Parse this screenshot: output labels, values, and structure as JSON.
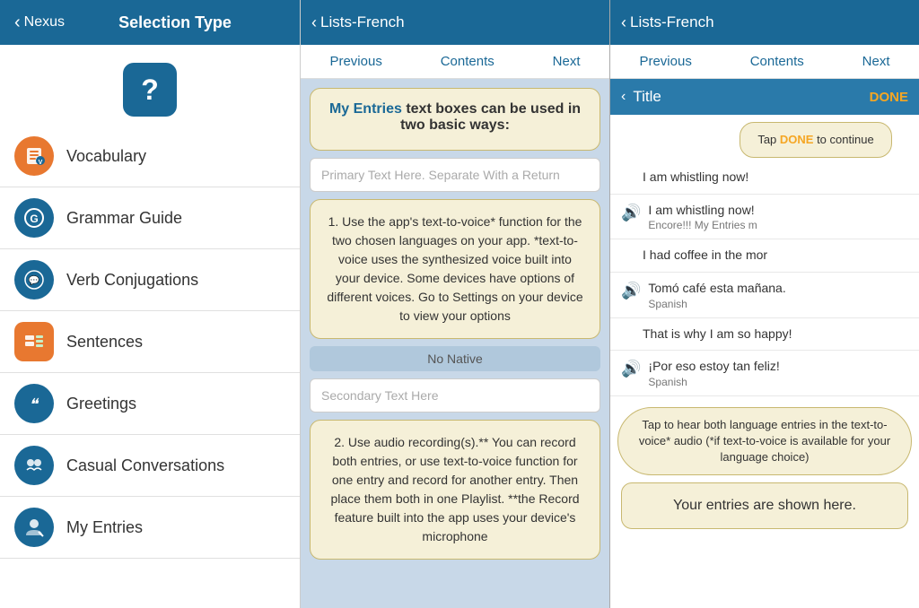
{
  "left": {
    "back_label": "Nexus",
    "title": "Selection Type",
    "items": [
      {
        "id": "vocabulary",
        "label": "Vocabulary",
        "icon": "📚",
        "icon_bg": "#1a6896"
      },
      {
        "id": "grammar",
        "label": "Grammar Guide",
        "icon": "📖",
        "icon_bg": "#1a6896"
      },
      {
        "id": "verb",
        "label": "Verb Conjugations",
        "icon": "💬",
        "icon_bg": "#1a6896"
      },
      {
        "id": "sentences",
        "label": "Sentences",
        "icon": "🔤",
        "icon_bg": "#e87830"
      },
      {
        "id": "greetings",
        "label": "Greetings",
        "icon": "❝",
        "icon_bg": "#1a6896"
      },
      {
        "id": "casual",
        "label": "Casual Conversations",
        "icon": "🤝",
        "icon_bg": "#1a6896"
      },
      {
        "id": "myentries",
        "label": "My Entries",
        "icon": "✍️",
        "icon_bg": "#1a6896"
      }
    ]
  },
  "middle": {
    "header": "Lists-French",
    "nav": {
      "previous": "Previous",
      "contents": "Contents",
      "next": "Next"
    },
    "info_title_1": "My Entries",
    "info_title_2": " text boxes can be used in two basic ways:",
    "instruction_1": "1. Use the app's text-to-voice* function for the two chosen languages on your app. *text-to-voice uses the synthesized voice built into your device. Some devices have options of different voices. Go to Settings on your device to view your options",
    "section_label": "No Native",
    "primary_placeholder": "Primary Text Here. Separate With a Return",
    "secondary_placeholder": "Secondary Text Here",
    "instruction_2": "2. Use audio recording(s).** You can record both entries, or use text-to-voice function for one entry and record for another entry. Then place them both in one Playlist. **the Record feature built into the app uses your device's microphone"
  },
  "right": {
    "header": "Lists-French",
    "nav": {
      "previous": "Previous",
      "contents": "Contents",
      "next": "Next"
    },
    "title_bar": {
      "back": "‹",
      "title": "Title",
      "done": "DONE"
    },
    "tooltip_done": "Tap ",
    "tooltip_done_highlight": "DONE",
    "tooltip_done_suffix": " to continue",
    "entries": [
      {
        "text": "I am whistling now!",
        "sub": "",
        "has_speaker": false
      },
      {
        "text": "I am whistling now!",
        "sub": "Encore!!! My Entries m",
        "has_speaker": true
      },
      {
        "text": "I had coffee in the mor",
        "sub": "",
        "has_speaker": false
      },
      {
        "text": "Tomó café esta mañana.",
        "sub": "Spanish",
        "has_speaker": true
      },
      {
        "text": "That is why I am so happy!",
        "sub": "",
        "has_speaker": false
      },
      {
        "text": "¡Por eso estoy tan feliz!",
        "sub": "Spanish",
        "has_speaker": true
      }
    ],
    "tooltip_tap": "Tap to hear both language entries in the text-to-voice* audio (*if text-to-voice is available for your language choice)",
    "bottom_box": "Your entries are shown here."
  }
}
